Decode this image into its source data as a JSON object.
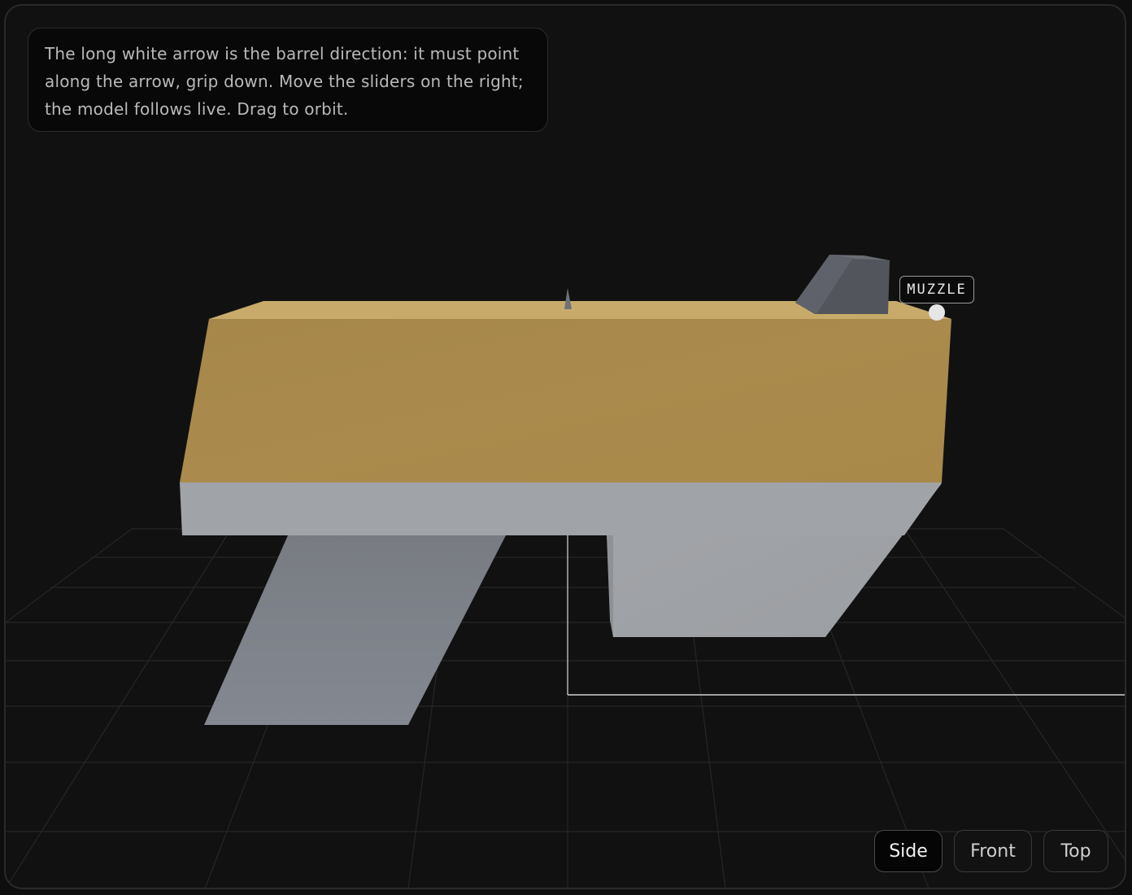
{
  "instructions": {
    "text": "The long white arrow is the barrel direction: it must point along the arrow, grip down. Move the sliders on the right; the model follows live. Drag to orbit."
  },
  "scene": {
    "muzzle_label": "MUZZLE",
    "colors": {
      "background": "#111111",
      "slide": "#a98a4c",
      "slide_top": "#c4a869",
      "frame_body": "#a0a3a7",
      "grip": "#7d8187",
      "rear_sight": "#52555c",
      "grid_line": "#2a2a2a",
      "axis_line": "#cfcfcf"
    }
  },
  "view_buttons": [
    {
      "label": "Side",
      "active": true
    },
    {
      "label": "Front",
      "active": false
    },
    {
      "label": "Top",
      "active": false
    }
  ]
}
